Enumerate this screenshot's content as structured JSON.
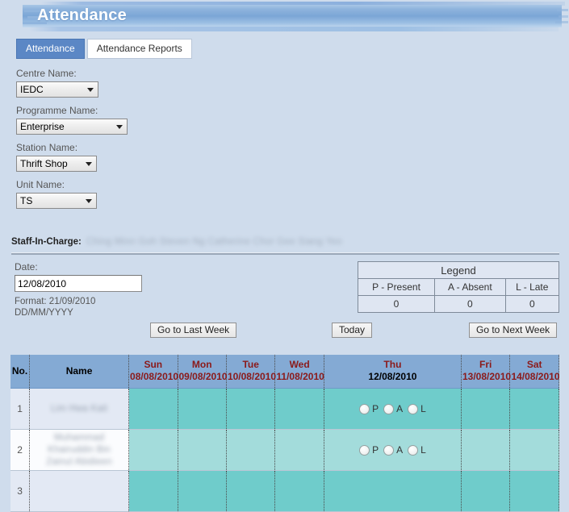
{
  "banner": {
    "title": "Attendance"
  },
  "tabs": [
    {
      "label": "Attendance",
      "active": true
    },
    {
      "label": "Attendance Reports",
      "active": false
    }
  ],
  "form": {
    "centre": {
      "label": "Centre Name:",
      "value": "IEDC"
    },
    "programme": {
      "label": "Programme Name:",
      "value": "Enterprise"
    },
    "station": {
      "label": "Station Name:",
      "value": "Thrift Shop"
    },
    "unit": {
      "label": "Unit Name:",
      "value": "TS"
    }
  },
  "staff": {
    "label": "Staff-In-Charge:",
    "names": "Ching Minn Goh Steven  Ng Catherine  Chor Gee Siang Yeo"
  },
  "date": {
    "label": "Date:",
    "value": "12/08/2010",
    "format_line1": "Format: 21/09/2010",
    "format_line2": "DD/MM/YYYY"
  },
  "legend": {
    "title": "Legend",
    "items": [
      {
        "label": "P - Present",
        "count": "0"
      },
      {
        "label": "A - Absent",
        "count": "0"
      },
      {
        "label": "L - Late",
        "count": "0"
      }
    ]
  },
  "nav_buttons": {
    "last_week": "Go to Last Week",
    "today": "Today",
    "next_week": "Go to Next Week"
  },
  "table": {
    "headers": {
      "no": "No.",
      "name": "Name",
      "days": [
        {
          "dow": "Sun",
          "date": "08/08/2010",
          "selected": false
        },
        {
          "dow": "Mon",
          "date": "09/08/2010",
          "selected": false
        },
        {
          "dow": "Tue",
          "date": "10/08/2010",
          "selected": false
        },
        {
          "dow": "Wed",
          "date": "11/08/2010",
          "selected": false
        },
        {
          "dow": "Thu",
          "date": "12/08/2010",
          "selected": true
        },
        {
          "dow": "Fri",
          "date": "13/08/2010",
          "selected": false
        },
        {
          "dow": "Sat",
          "date": "14/08/2010",
          "selected": false
        }
      ]
    },
    "marks": [
      {
        "code": "P"
      },
      {
        "code": "A"
      },
      {
        "code": "L"
      }
    ],
    "rows": [
      {
        "no": "1",
        "name_lines": [
          "Lim Hwa Kait"
        ]
      },
      {
        "no": "2",
        "name_lines": [
          "Muhammad",
          "Khairuddin Bin",
          "Zainul Abidieen"
        ]
      },
      {
        "no": "3",
        "name_lines": [
          ""
        ]
      }
    ]
  }
}
